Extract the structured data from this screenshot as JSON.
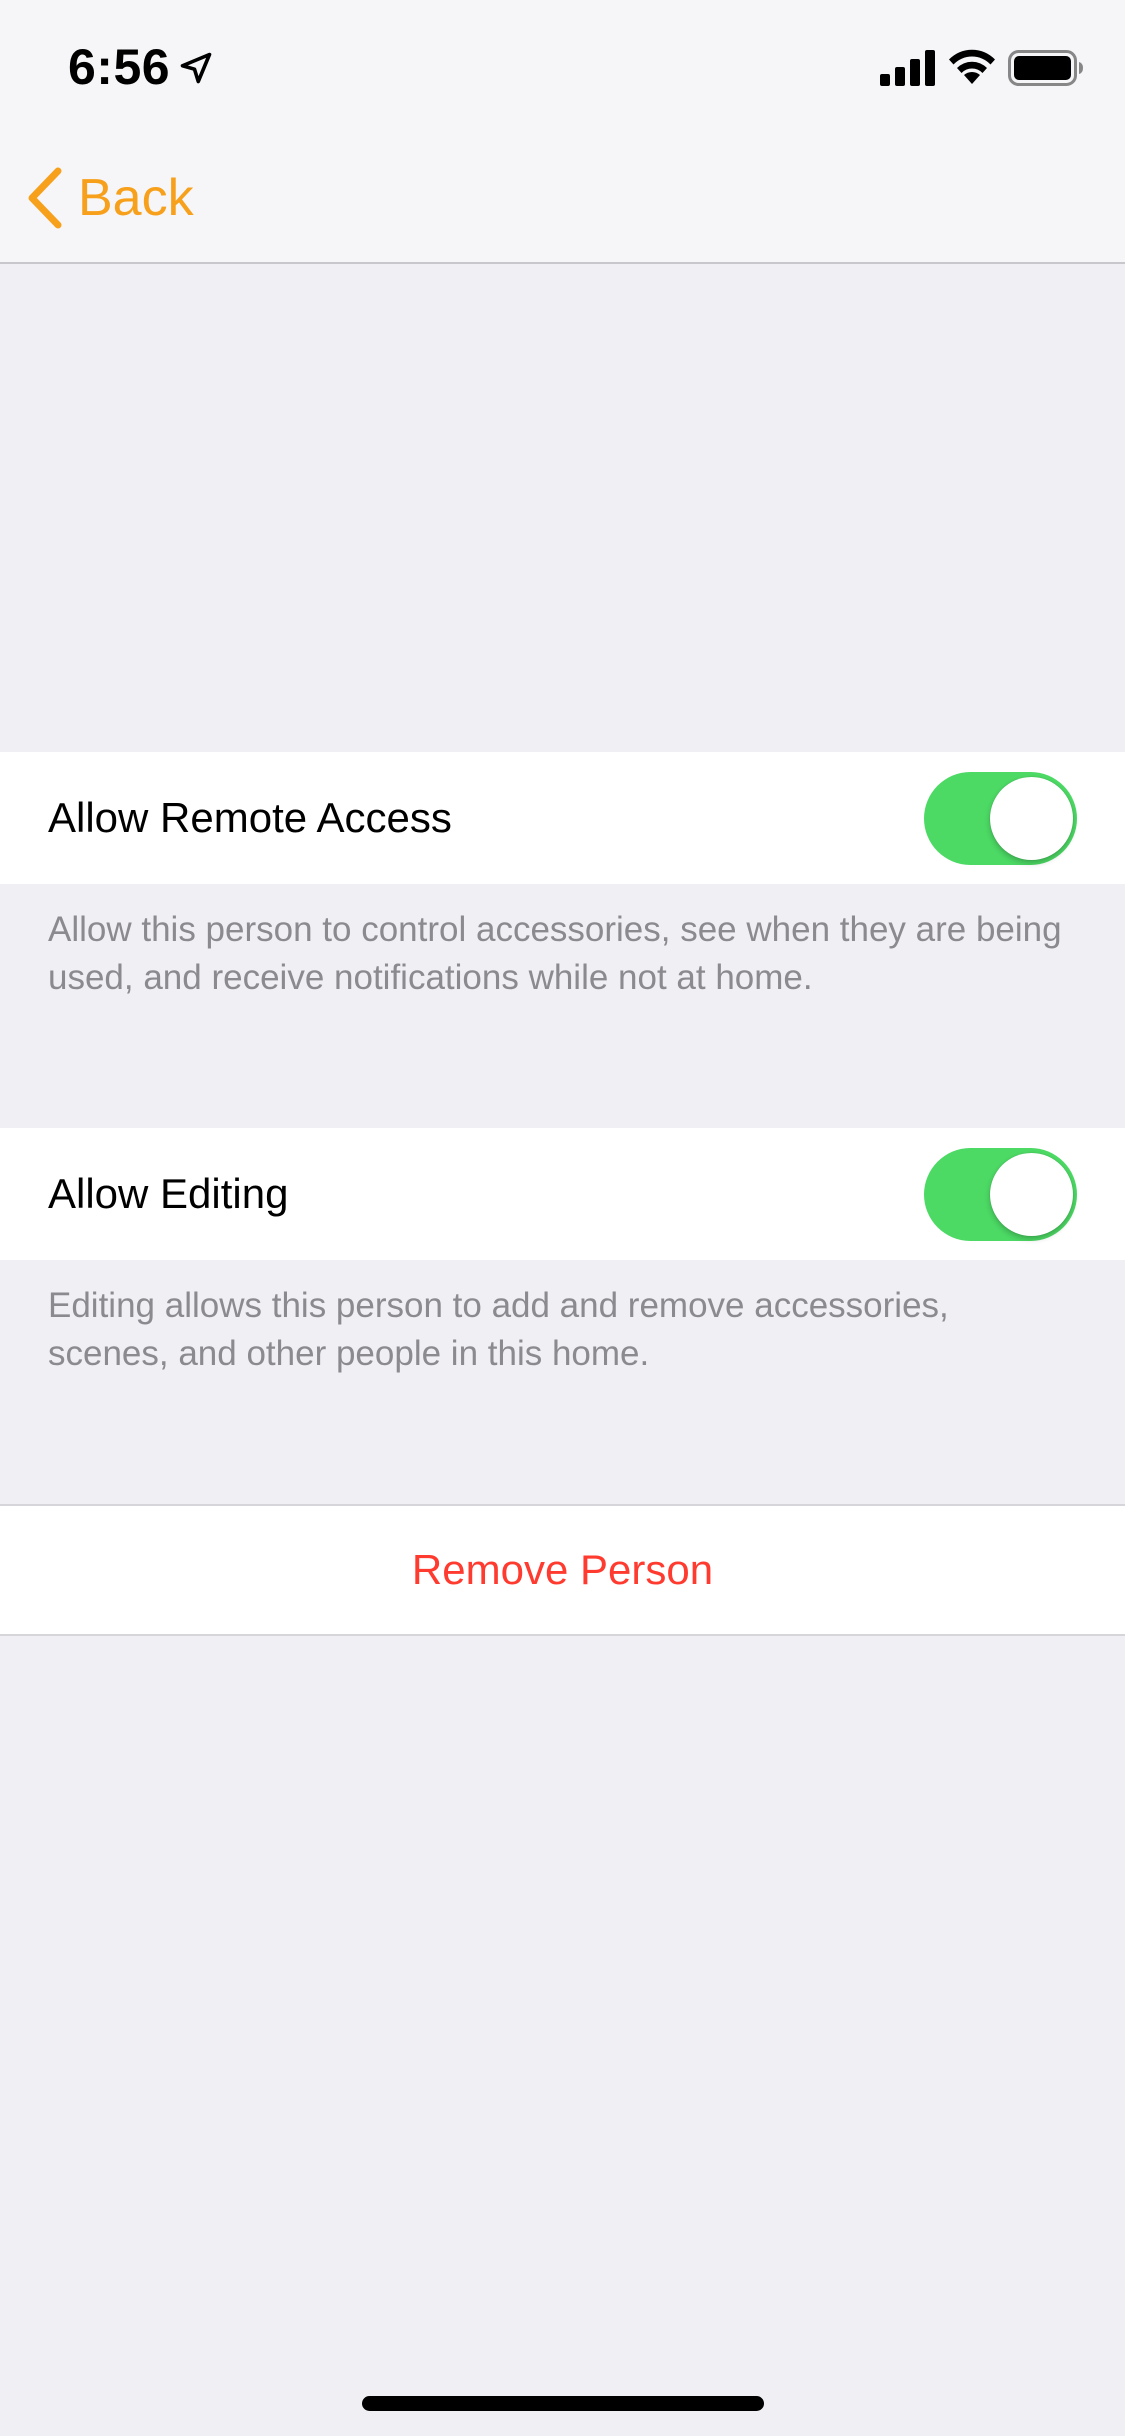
{
  "status_bar": {
    "time": "6:56",
    "icons": [
      "location-arrow-icon",
      "cellular-signal-icon",
      "wifi-icon",
      "battery-icon"
    ]
  },
  "nav": {
    "back_label": "Back",
    "accent_color": "#f7a01c"
  },
  "settings": {
    "remote_access": {
      "label": "Allow Remote Access",
      "enabled": true,
      "footer": "Allow this person to control accessories, see when they are being used, and receive notifications while not at home."
    },
    "editing": {
      "label": "Allow Editing",
      "enabled": true,
      "footer": "Editing allows this person to add and remove accessories, scenes, and other people in this home."
    }
  },
  "actions": {
    "remove_label": "Remove Person",
    "remove_color": "#ff3b30"
  },
  "colors": {
    "toggle_on": "#4cd964",
    "background": "#efeff4"
  }
}
